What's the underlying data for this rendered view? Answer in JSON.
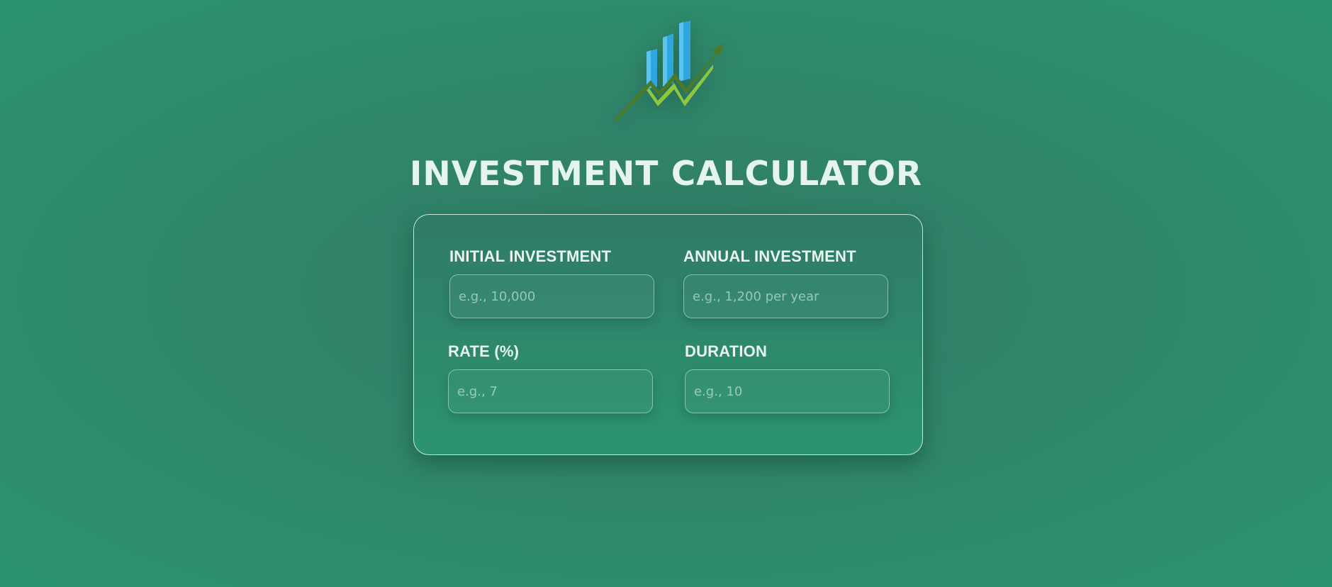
{
  "header": {
    "logo_icon": "growth-chart-logo-icon",
    "title": "INVESTMENT CALCULATOR"
  },
  "form": {
    "initial_investment": {
      "label": "INITIAL INVESTMENT",
      "placeholder": "e.g., 10,000",
      "value": ""
    },
    "annual_investment": {
      "label": "ANNUAL INVESTMENT",
      "placeholder": "e.g., 1,200 per year",
      "value": ""
    },
    "rate": {
      "label": "RATE (%)",
      "placeholder": "e.g., 7",
      "value": ""
    },
    "duration": {
      "label": "DURATION",
      "placeholder": "e.g., 10",
      "value": ""
    }
  },
  "colors": {
    "background": "#2e8b6c",
    "text": "#e6f4ee",
    "logo_bar": "#2ea7e0",
    "logo_arrow_dark": "#4a7a2a",
    "logo_arrow_light": "#8dc63f"
  }
}
